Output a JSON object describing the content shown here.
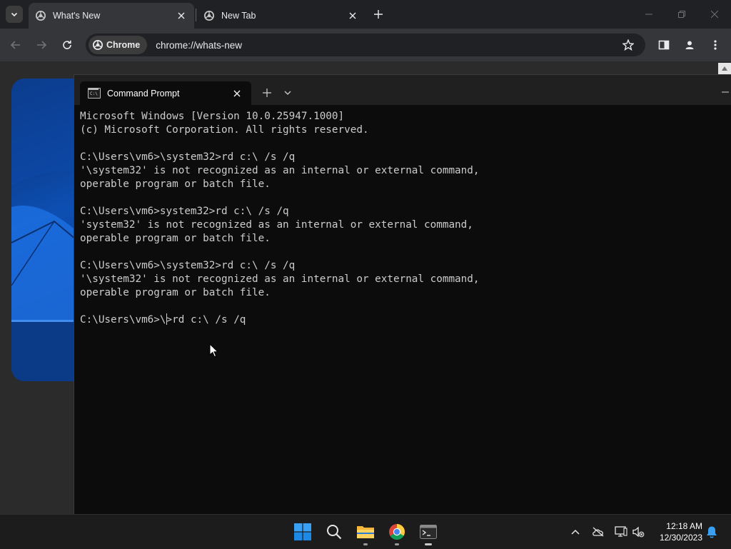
{
  "chrome": {
    "tabs": [
      {
        "label": "What's New",
        "active": true
      },
      {
        "label": "New Tab",
        "active": false
      }
    ],
    "chip_label": "Chrome",
    "url": "chrome://whats-new"
  },
  "terminal": {
    "tab_title": "Command Prompt",
    "lines": [
      "Microsoft Windows [Version 10.0.25947.1000]",
      "(c) Microsoft Corporation. All rights reserved.",
      "",
      "C:\\Users\\vm6>\\system32>rd c:\\ /s /q",
      "'\\system32' is not recognized as an internal or external command,",
      "operable program or batch file.",
      "",
      "C:\\Users\\vm6>system32>rd c:\\ /s /q",
      "'system32' is not recognized as an internal or external command,",
      "operable program or batch file.",
      "",
      "C:\\Users\\vm6>\\system32>rd c:\\ /s /q",
      "'\\system32' is not recognized as an internal or external command,",
      "operable program or batch file.",
      ""
    ],
    "current_prompt_before_caret": "C:\\Users\\vm6>\\",
    "current_prompt_after_caret": ">rd c:\\ /s /q"
  },
  "taskbar": {
    "apps": [
      "start-icon",
      "search-icon",
      "file-explorer-icon",
      "chrome-icon",
      "terminal-icon"
    ],
    "time": "12:18 AM",
    "date": "12/30/2023"
  },
  "colors": {
    "terminal_bg": "#0c0c0c",
    "terminal_fg": "#cccccc",
    "chrome_frame": "#202124",
    "chrome_toolbar": "#35363a",
    "taskbar_bg": "#1c1c1c"
  }
}
